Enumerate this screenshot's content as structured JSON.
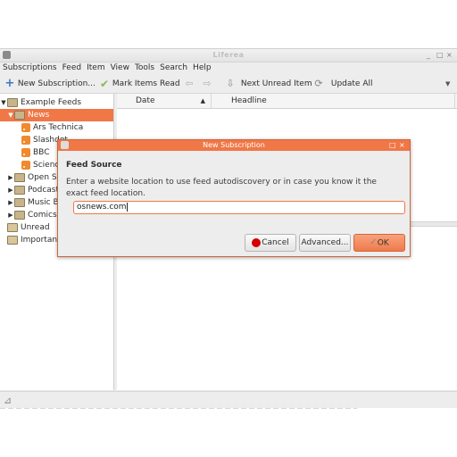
{
  "window": {
    "title": "Liferea",
    "controls": [
      "_",
      "□",
      "×"
    ]
  },
  "menu": [
    "Subscriptions",
    "Feed",
    "Item",
    "View",
    "Tools",
    "Search",
    "Help"
  ],
  "toolbar": {
    "new_subscription": "New Subscription...",
    "mark_items_read": "Mark Items Read",
    "next_unread": "Next Unread Item",
    "update_all": "Update All"
  },
  "sidebar": {
    "items": [
      {
        "label": "Example Feeds",
        "kind": "folder",
        "expanded": true
      },
      {
        "label": "News",
        "kind": "folder",
        "expanded": true,
        "selected": true
      },
      {
        "label": "Ars Technica",
        "kind": "feed"
      },
      {
        "label": "Slashdot",
        "kind": "feed"
      },
      {
        "label": "BBC",
        "kind": "feed"
      },
      {
        "label": "Science",
        "kind": "feed"
      },
      {
        "label": "Open Sou",
        "kind": "folder",
        "expanded": false
      },
      {
        "label": "Podcasts",
        "kind": "folder",
        "expanded": false
      },
      {
        "label": "Music Blo",
        "kind": "folder",
        "expanded": false
      },
      {
        "label": "Comics",
        "kind": "folder",
        "expanded": false
      },
      {
        "label": "Unread",
        "kind": "vfolder"
      },
      {
        "label": "Important",
        "kind": "vfolder"
      }
    ]
  },
  "itemlist": {
    "columns": [
      "Date",
      "Headline"
    ],
    "sort_indicator": "▲"
  },
  "dialog": {
    "title": "New Subscription",
    "heading": "Feed Source",
    "description": "Enter a website location to use feed autodiscovery or in case you know it the exact feed location.",
    "url_value": "osnews.com",
    "cancel_label": "Cancel",
    "advanced_label": "Advanced...",
    "ok_label": "OK",
    "accent": "#f07746"
  }
}
